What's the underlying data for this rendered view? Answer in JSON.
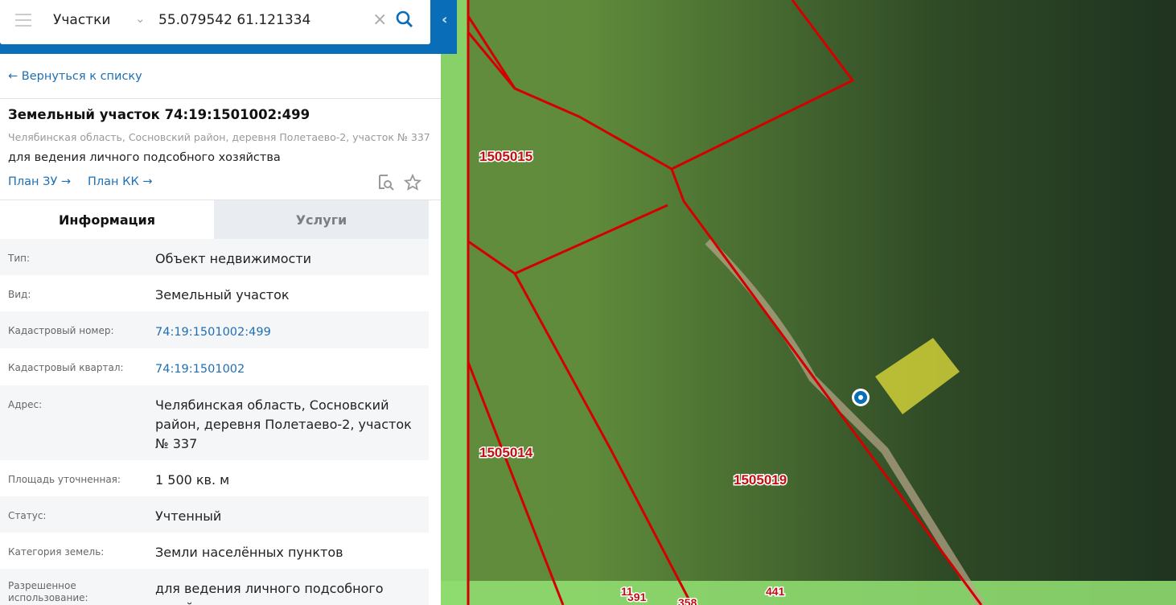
{
  "search": {
    "layer": "Участки",
    "query": "55.079542 61.121334"
  },
  "back_link": "Вернуться к списку",
  "parcel": {
    "title": "Земельный участок 74:19:1501002:499",
    "address": "Челябинская область, Сосновский район, деревня Полетаево-2, участок № 337",
    "purpose": "для ведения личного подсобного хозяйства",
    "links": [
      "План ЗУ →",
      "План КК →"
    ]
  },
  "tabs": [
    {
      "label": "Информация",
      "active": true
    },
    {
      "label": "Услуги",
      "active": false
    }
  ],
  "rows": [
    {
      "k": "Тип:",
      "v": "Объект недвижимости"
    },
    {
      "k": "Вид:",
      "v": "Земельный участок"
    },
    {
      "k": "Кадастровый номер:",
      "v": "74:19:1501002:499"
    },
    {
      "k": "Кадастровый квартал:",
      "v": "74:19:1501002"
    },
    {
      "k": "Адрес:",
      "v": "Челябинская область, Сосновский район, деревня Полетаево-2, участок № 337"
    },
    {
      "k": "Площадь уточненная:",
      "v": "1 500 кв. м"
    },
    {
      "k": "Статус:",
      "v": "Учтенный"
    },
    {
      "k": "Категория земель:",
      "v": "Земли населённых пунктов"
    },
    {
      "k": "Разрешенное использование:",
      "v": "для ведения личного подсобного хозяйства"
    }
  ],
  "map": {
    "labels": [
      "1505015",
      "1505014",
      "1505019",
      "391",
      "11",
      "441",
      "358"
    ],
    "accent": "#0a6db8",
    "boundary_color": "#d40000",
    "parcel_color": "#e6e03a"
  }
}
